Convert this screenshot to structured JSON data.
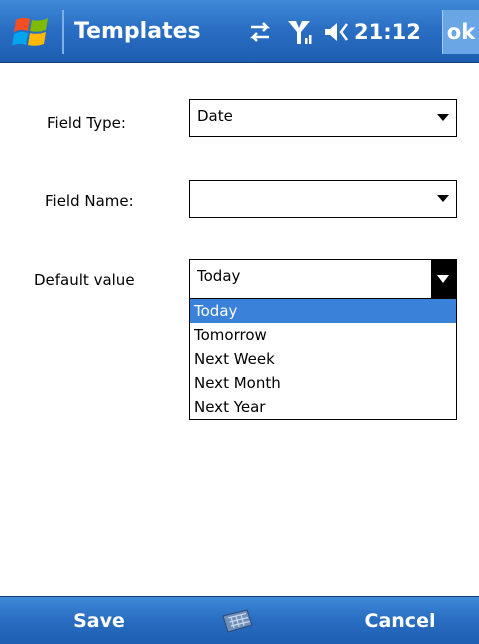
{
  "titlebar": {
    "title": "Templates",
    "clock": "21:12",
    "ok_label": "ok",
    "icons": {
      "start": "windows-flag-icon",
      "connectivity": "connectivity-icon",
      "signal": "signal-icon",
      "volume": "volume-icon"
    }
  },
  "form": {
    "field_type": {
      "label": "Field Type:",
      "value": "Date"
    },
    "field_name": {
      "label": "Field Name:",
      "value": ""
    },
    "default_value": {
      "label": "Default value",
      "value": "Today",
      "options": [
        "Today",
        "Tomorrow",
        "Next Week",
        "Next Month",
        "Next Year"
      ],
      "selected_index": 0
    }
  },
  "menubar": {
    "left_softkey": "Save",
    "right_softkey": "Cancel",
    "center_icon": "keyboard-icon"
  },
  "colors": {
    "bar_blue": "#2a6fc4",
    "selection_blue": "#3a82d9",
    "ok_button": "#6aa5e6"
  }
}
